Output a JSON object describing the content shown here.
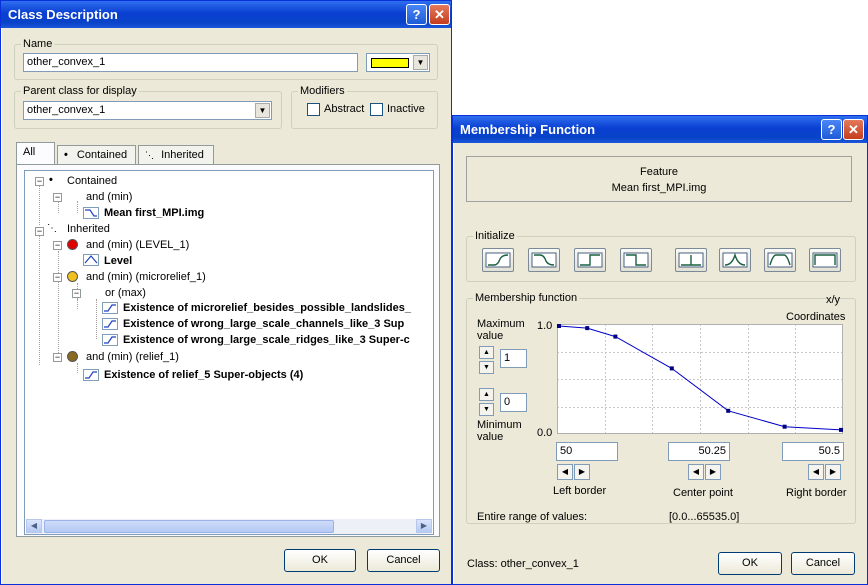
{
  "class_dialog": {
    "title": "Class Description",
    "help_label": "?",
    "close_label": "✕",
    "name_group": "Name",
    "name_value": "other_convex_1",
    "class_color": "#ffff00",
    "parent_group": "Parent class for display",
    "parent_value": "other_convex_1",
    "modifiers_group": "Modifiers",
    "abstract_label": "Abstract",
    "inactive_label": "Inactive",
    "tabs": [
      "All",
      "Contained",
      "Inherited"
    ],
    "tree": {
      "contained": "Contained",
      "and_min_1": "and (min)",
      "mean_feature": "Mean first_MPI.img",
      "inherited": "Inherited",
      "and_level": "and (min) (LEVEL_1)",
      "level": "Level",
      "and_microrelief": "and (min) (microrelief_1)",
      "or_max": "or (max)",
      "existence_1": "Existence of microrelief_besides_possible_landslides_",
      "existence_2": "Existence of wrong_large_scale_channels_like_3 Sup",
      "existence_3": "Existence of wrong_large_scale_ridges_like_3 Super-c",
      "and_relief": "and (min) (relief_1)",
      "existence_relief": "Existence of relief_5 Super-objects  (4)"
    },
    "node_colors": {
      "level": "#e00000",
      "microrelief": "#f0c020",
      "relief": "#8a6a20"
    },
    "ok_label": "OK",
    "cancel_label": "Cancel"
  },
  "membership_dialog": {
    "title": "Membership Function",
    "help_label": "?",
    "close_label": "✕",
    "feature_header": "Feature",
    "feature_name": "Mean first_MPI.img",
    "initialize_group": "Initialize",
    "init_buttons": [
      "larger-icon",
      "smaller-icon",
      "larger-boolean-icon",
      "smaller-boolean-icon",
      "single-value-icon",
      "approximate-gaussian-icon",
      "about-range-icon",
      "full-range-icon"
    ],
    "mf_group": "Membership function",
    "xy_label": "x/y",
    "coordinates_label": "Coordinates",
    "max_label": "Maximum value",
    "max_value": "1",
    "min_label": "Minimum value",
    "min_value": "0",
    "y_max_tick": "1.0",
    "y_min_tick": "0.0",
    "curve_points": [
      [
        50,
        1.0
      ],
      [
        50.05,
        0.98
      ],
      [
        50.1,
        0.9
      ],
      [
        50.2,
        0.6
      ],
      [
        50.3,
        0.2
      ],
      [
        50.4,
        0.05
      ],
      [
        50.5,
        0.02
      ]
    ],
    "left_border_value": "50",
    "center_point_value": "50.25",
    "right_border_value": "50.5",
    "left_border_label": "Left border",
    "center_point_label": "Center point",
    "right_border_label": "Right border",
    "range_label": "Entire range of values:",
    "range_value": "[0.0...65535.0]",
    "class_label": "Class: other_convex_1",
    "ok_label": "OK",
    "cancel_label": "Cancel"
  }
}
